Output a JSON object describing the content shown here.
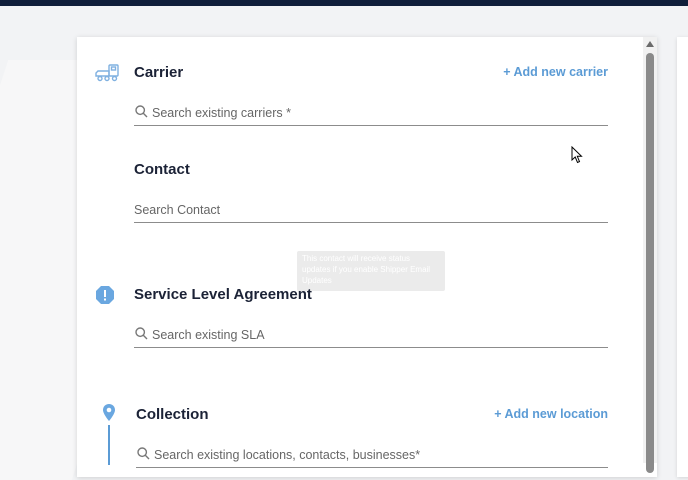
{
  "carrier": {
    "title": "Carrier",
    "add_link": "+ Add new carrier",
    "search_placeholder": "Search existing carriers *",
    "icon": "truck-icon"
  },
  "contact": {
    "title": "Contact",
    "search_placeholder": "Search Contact",
    "tooltip": "This contact will receive status updates if you enable Shipper Email Updates"
  },
  "sla": {
    "title": "Service Level Agreement",
    "search_placeholder": "Search existing SLA",
    "icon": "alert-octagon-icon"
  },
  "collection": {
    "title": "Collection",
    "add_link": "+ Add new location",
    "search_placeholder": "Search existing locations, contacts, businesses*",
    "icon": "map-pin-icon"
  },
  "colors": {
    "accent": "#5b9bd5",
    "title": "#1b2236",
    "topbar": "#0f1e3a"
  }
}
